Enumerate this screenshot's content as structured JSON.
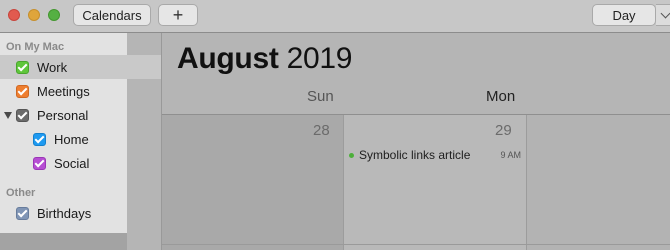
{
  "toolbar": {
    "calendars_label": "Calendars",
    "add_label": "+",
    "view_label": "Day"
  },
  "sidebar": {
    "groups": [
      {
        "header": "On My Mac",
        "items": [
          {
            "label": "Work",
            "color": "#5fc63b",
            "checked": true,
            "selected": true
          },
          {
            "label": "Meetings",
            "color": "#ee7e2f",
            "checked": true
          },
          {
            "label": "Personal",
            "color": "#6b6b6b",
            "checked": true,
            "expanded": true
          },
          {
            "label": "Home",
            "color": "#1e9af1",
            "checked": true
          },
          {
            "label": "Social",
            "color": "#b64dd3",
            "checked": true
          }
        ]
      },
      {
        "header": "Other",
        "items": [
          {
            "label": "Birthdays",
            "color": "#8095b5",
            "checked": true
          }
        ]
      }
    ]
  },
  "main": {
    "month_name": "August",
    "year": "2019",
    "day_headers": [
      "Sun",
      "Mon"
    ],
    "dates": [
      "28",
      "29"
    ],
    "event": {
      "title": "Symbolic links article",
      "time": "9 AM",
      "color": "#4caf3a"
    }
  }
}
